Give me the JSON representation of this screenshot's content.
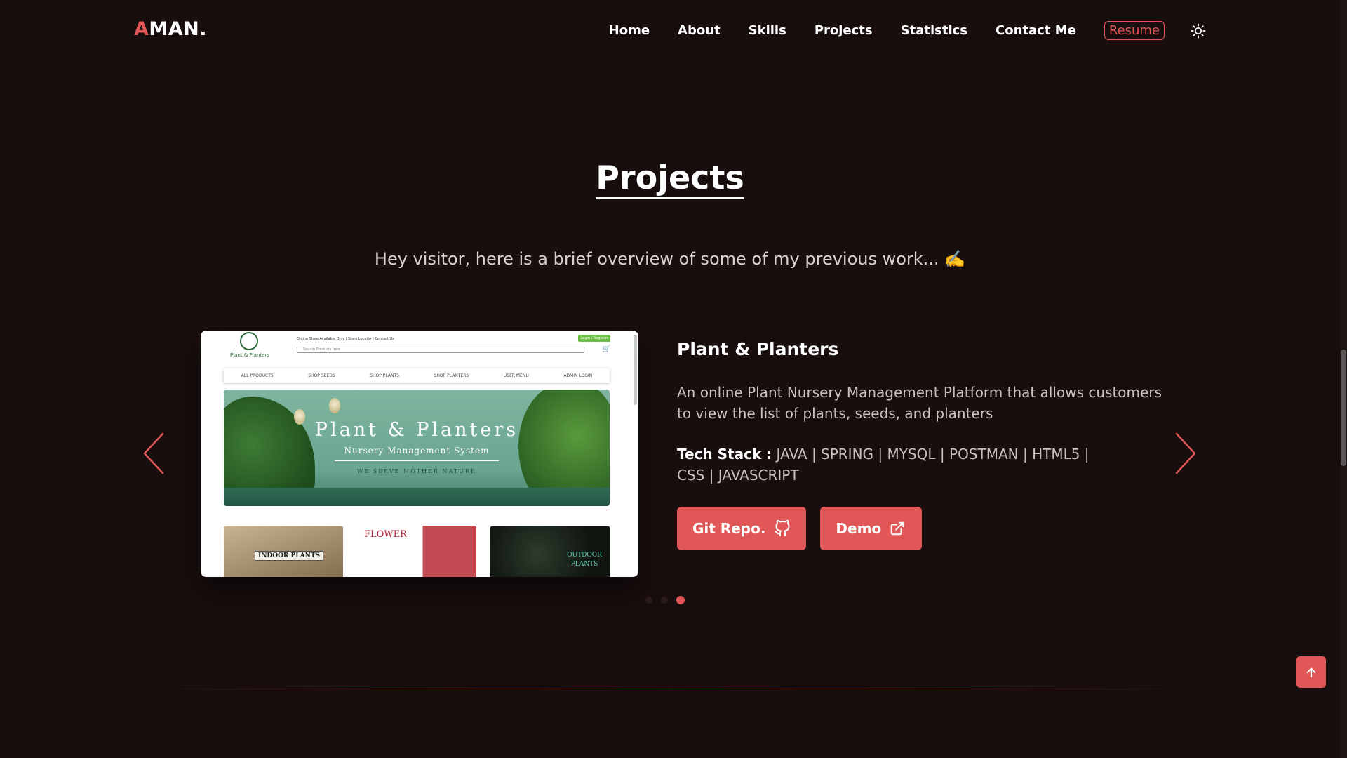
{
  "logo": {
    "accent": "A",
    "rest": "MAN."
  },
  "nav": {
    "items": [
      {
        "label": "Home"
      },
      {
        "label": "About"
      },
      {
        "label": "Skills"
      },
      {
        "label": "Projects"
      },
      {
        "label": "Statistics"
      },
      {
        "label": "Contact Me"
      }
    ],
    "resume_label": "Resume",
    "theme_icon": "sun-icon"
  },
  "section": {
    "title": "Projects",
    "subtitle": "Hey visitor, here is a brief overview of some of my previous work... ✍️"
  },
  "project": {
    "title": "Plant & Planters",
    "description": "An online Plant Nursery Management Platform that allows customers to view the list of plants, seeds, and planters",
    "stack_label": "Tech Stack :",
    "stack_value": "JAVA | SPRING | MYSQL | POSTMAN | HTML5 | CSS | JAVASCRIPT",
    "buttons": {
      "git": {
        "label": "Git Repo.",
        "icon": "github-icon"
      },
      "demo": {
        "label": "Demo",
        "icon": "external-link-icon"
      }
    },
    "screenshot": {
      "logo_text": "Plant & Planters",
      "top_links": "Online Store Available Only | Store Locator | Contact Us",
      "search_placeholder": "Search Products here",
      "login": "Login / Register",
      "menu": [
        "ALL PRODUCTS",
        "SHOP SEEDS",
        "SHOP PLANTS",
        "SHOP PLANTERS",
        "USER MENU",
        "ADMIN LOGIN"
      ],
      "banner_title": "Plant & Planters",
      "banner_subtitle": "Nursery Management System",
      "banner_tagline": "WE SERVE MOTHER NATURE",
      "tiles": [
        "INDOOR PLANTS",
        "FLOWER",
        "OUTDOOR PLANTS"
      ]
    }
  },
  "carousel": {
    "slide_count": 3,
    "active_index": 2
  },
  "colors": {
    "accent": "#e15757",
    "background": "#190e0e",
    "text": "#ffffff",
    "muted_text": "#c9c2c2"
  }
}
